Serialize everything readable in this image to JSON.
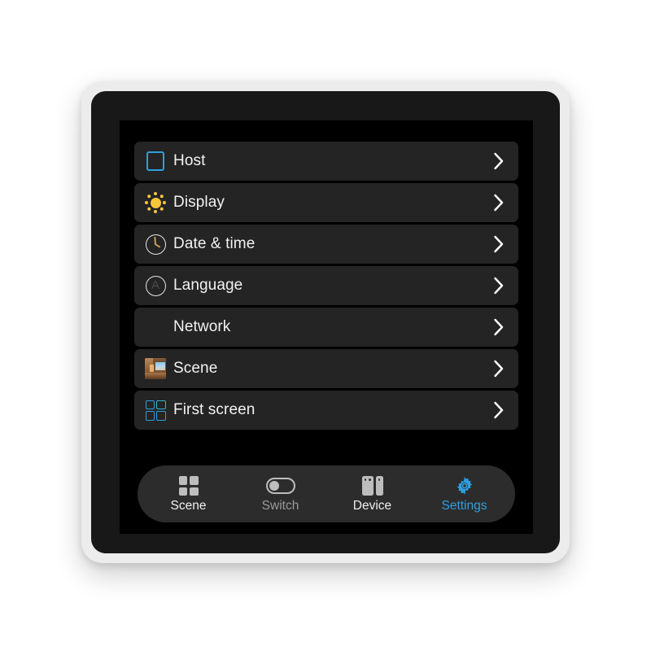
{
  "app": {
    "screen_title": "Settings",
    "theme_accent": "#2f9fe0",
    "screen_background": "#000000",
    "row_background": "#242424",
    "nav_background": "#2c2c2c"
  },
  "settings_list": {
    "rows": [
      {
        "label": "Host",
        "icon": "host-square-icon",
        "chevron": "chevron-right-icon"
      },
      {
        "label": "Display",
        "icon": "sun-icon",
        "chevron": "chevron-right-icon"
      },
      {
        "label": "Date & time",
        "icon": "clock-icon",
        "chevron": "chevron-right-icon"
      },
      {
        "label": "Language",
        "icon": "language-circle-a-icon",
        "icon_letter": "A",
        "chevron": "chevron-right-icon"
      },
      {
        "label": "Network",
        "icon": "none",
        "chevron": "chevron-right-icon"
      },
      {
        "label": "Scene",
        "icon": "scene-photo-icon",
        "chevron": "chevron-right-icon"
      },
      {
        "label": "First screen",
        "icon": "grid-four-icon",
        "chevron": "chevron-right-icon"
      }
    ]
  },
  "bottom_nav": {
    "items": [
      {
        "label": "Scene",
        "icon": "grid-four-icon",
        "active": false
      },
      {
        "label": "Switch",
        "icon": "toggle-off-icon",
        "active": false,
        "dim": true
      },
      {
        "label": "Device",
        "icon": "device-panels-icon",
        "active": false
      },
      {
        "label": "Settings",
        "icon": "gear-icon",
        "active": true
      }
    ]
  }
}
